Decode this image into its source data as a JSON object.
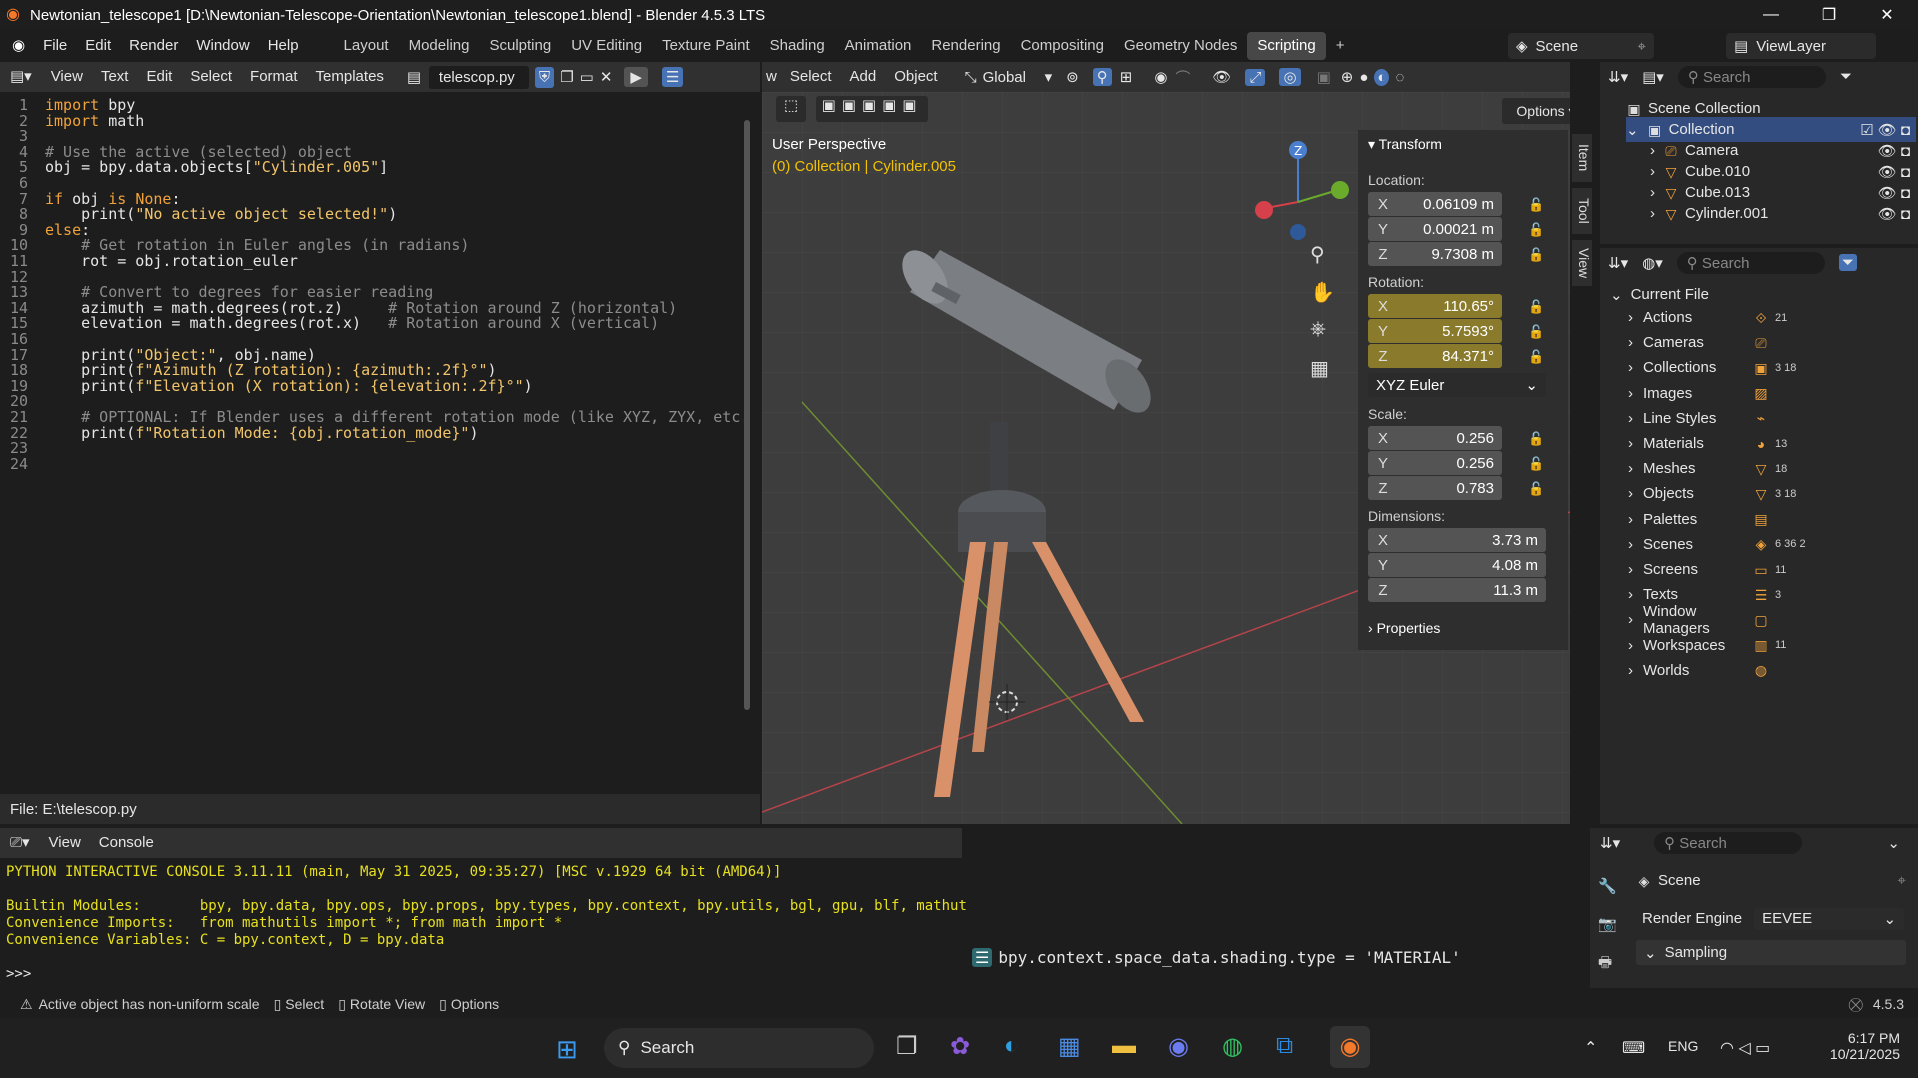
{
  "window": {
    "title": "Newtonian_telescope1 [D:\\Newtonian-Telescope-Orientation\\Newtonian_telescope1.blend] - Blender 4.5.3 LTS"
  },
  "menu": [
    "File",
    "Edit",
    "Render",
    "Window",
    "Help"
  ],
  "workspaces": [
    "Layout",
    "Modeling",
    "Sculpting",
    "UV Editing",
    "Texture Paint",
    "Shading",
    "Animation",
    "Rendering",
    "Compositing",
    "Geometry Nodes",
    "Scripting"
  ],
  "scene": {
    "scene_label": "Scene",
    "viewlayer_label": "ViewLayer"
  },
  "text_editor": {
    "menu": [
      "View",
      "Text",
      "Edit",
      "Select",
      "Format",
      "Templates"
    ],
    "filename": "telescop.py",
    "footer": "File: E:\\telescop.py",
    "lines": [
      "import bpy",
      "import math",
      "",
      "# Use the active (selected) object",
      "obj = bpy.data.objects[\"Cylinder.005\"]",
      "",
      "if obj is None:",
      "    print(\"No active object selected!\")",
      "else:",
      "    # Get rotation in Euler angles (in radians)",
      "    rot = obj.rotation_euler",
      "",
      "    # Convert to degrees for easier reading",
      "    azimuth = math.degrees(rot.z)     # Rotation around Z (horizontal)",
      "    elevation = math.degrees(rot.x)   # Rotation around X (vertical)",
      "",
      "    print(\"Object:\", obj.name)",
      "    print(f\"Azimuth (Z rotation): {azimuth:.2f}°\")",
      "    print(f\"Elevation (X rotation): {elevation:.2f}°\")",
      "",
      "    # OPTIONAL: If Blender uses a different rotation mode (like XYZ, ZYX, etc.",
      "    print(f\"Rotation Mode: {obj.rotation_mode}\")",
      "",
      ""
    ]
  },
  "viewport": {
    "menu": [
      "w",
      "Select",
      "Add",
      "Object"
    ],
    "orientation": "Global",
    "options_label": "Options",
    "perspective": "User Perspective",
    "collection_info": "(0) Collection | Cylinder.005",
    "gizmo_axis": "Z"
  },
  "n_panel": {
    "transform_title": "Transform",
    "location_label": "Location:",
    "location": [
      {
        "axis": "X",
        "value": "0.06109 m"
      },
      {
        "axis": "Y",
        "value": "0.00021 m"
      },
      {
        "axis": "Z",
        "value": "9.7308 m"
      }
    ],
    "rotation_label": "Rotation:",
    "rotation": [
      {
        "axis": "X",
        "value": "110.65°"
      },
      {
        "axis": "Y",
        "value": "5.7593°"
      },
      {
        "axis": "Z",
        "value": "84.371°"
      }
    ],
    "rotation_mode": "XYZ Euler",
    "scale_label": "Scale:",
    "scale": [
      {
        "axis": "X",
        "value": "0.256"
      },
      {
        "axis": "Y",
        "value": "0.256"
      },
      {
        "axis": "Z",
        "value": "0.783"
      }
    ],
    "dimensions_label": "Dimensions:",
    "dimensions": [
      {
        "axis": "X",
        "value": "3.73 m"
      },
      {
        "axis": "Y",
        "value": "4.08 m"
      },
      {
        "axis": "Z",
        "value": "11.3 m"
      }
    ],
    "properties_title": "Properties",
    "tabs": [
      "Item",
      "Tool",
      "View"
    ]
  },
  "outliner": {
    "search_placeholder": "Search",
    "root": "Scene Collection",
    "collection": "Collection",
    "items": [
      "Camera",
      "Cube.010",
      "Cube.013",
      "Cylinder.001"
    ]
  },
  "data_browser": {
    "search_placeholder": "Search",
    "root": "Current File",
    "items": [
      {
        "label": "Actions",
        "badge": "21"
      },
      {
        "label": "Cameras",
        "badge": ""
      },
      {
        "label": "Collections",
        "badge": "3 18"
      },
      {
        "label": "Images",
        "badge": ""
      },
      {
        "label": "Line Styles",
        "badge": ""
      },
      {
        "label": "Materials",
        "badge": "13"
      },
      {
        "label": "Meshes",
        "badge": "18"
      },
      {
        "label": "Objects",
        "badge": "3 18"
      },
      {
        "label": "Palettes",
        "badge": ""
      },
      {
        "label": "Scenes",
        "badge": "6 36 2"
      },
      {
        "label": "Screens",
        "badge": "11"
      },
      {
        "label": "Texts",
        "badge": "3"
      },
      {
        "label": "Window Managers",
        "badge": ""
      },
      {
        "label": "Workspaces",
        "badge": "11"
      },
      {
        "label": "Worlds",
        "badge": ""
      }
    ]
  },
  "console": {
    "menu": [
      "View",
      "Console"
    ],
    "lines": [
      "PYTHON INTERACTIVE CONSOLE 3.11.11 (main, May 31 2025, 09:35:27) [MSC v.1929 64 bit (AMD64)]",
      "",
      "Builtin Modules:       bpy, bpy.data, bpy.ops, bpy.props, bpy.types, bpy.context, bpy.utils, bgl, gpu, blf, mathutils",
      "Convenience Imports:   from mathutils import *; from math import *",
      "Convenience Variables: C = bpy.context, D = bpy.data",
      "",
      ">>> "
    ]
  },
  "info": {
    "line": "bpy.context.space_data.shading.type = 'MATERIAL'"
  },
  "properties": {
    "search_placeholder": "Search",
    "scene_title": "Scene",
    "render_engine_label": "Render Engine",
    "render_engine_value": "EEVEE",
    "sampling": "Sampling"
  },
  "status": {
    "warning": "Active object has non-uniform scale",
    "select": "Select",
    "rotate": "Rotate View",
    "options": "Options",
    "version": "4.5.3"
  },
  "taskbar": {
    "search": "Search",
    "lang": "ENG",
    "time": "6:17 PM",
    "date": "10/21/2025"
  }
}
